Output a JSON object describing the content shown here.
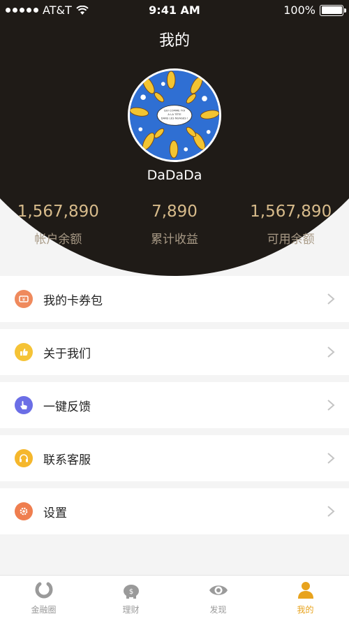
{
  "status_bar": {
    "carrier": "AT&T",
    "time": "9:41 AM",
    "battery": "100%"
  },
  "header": {
    "title": "我的"
  },
  "profile": {
    "username": "DaDaDa",
    "avatar_text": "QUI COMME TOI A LA TÊTE DANS LES NUAGES !"
  },
  "stats": [
    {
      "value": "1,567,890",
      "label": "帐户余额"
    },
    {
      "value": "7,890",
      "label": "累计收益"
    },
    {
      "value": "1,567,890",
      "label": "可用余额"
    }
  ],
  "menu": [
    {
      "label": "我的卡券包",
      "icon": "coupon-icon",
      "color": "#ef8a5d"
    },
    {
      "label": "关于我们",
      "icon": "thumb-icon",
      "color": "#f5c336"
    },
    {
      "label": "一键反馈",
      "icon": "hand-pointer-icon",
      "color": "#6b6ee6"
    },
    {
      "label": "联系客服",
      "icon": "headset-icon",
      "color": "#f5b72c"
    },
    {
      "label": "设置",
      "icon": "gear-icon",
      "color": "#ef7e4f"
    }
  ],
  "tabs": [
    {
      "label": "金融圈",
      "icon": "finance-circle-icon",
      "active": false
    },
    {
      "label": "理财",
      "icon": "piggy-bank-icon",
      "active": false
    },
    {
      "label": "发现",
      "icon": "eye-icon",
      "active": false
    },
    {
      "label": "我的",
      "icon": "person-icon",
      "active": true
    }
  ],
  "colors": {
    "header_bg": "#1f1b17",
    "stat_value": "#d7bb8b",
    "accent": "#e8a31d"
  }
}
